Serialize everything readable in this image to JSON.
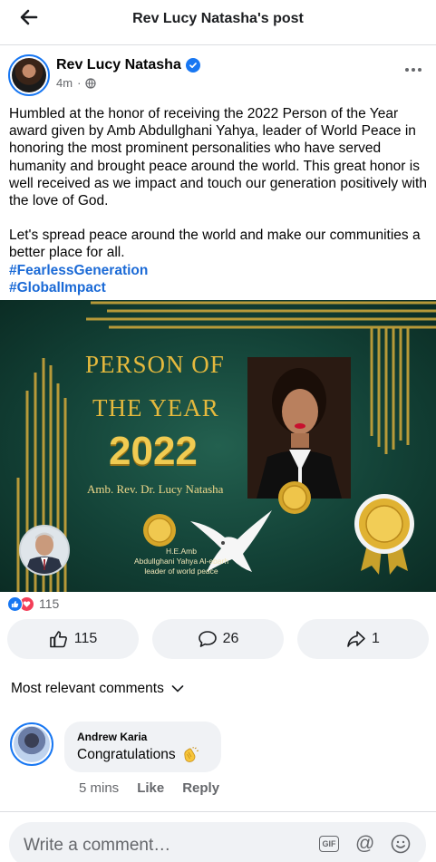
{
  "topbar": {
    "title": "Rev Lucy Natasha's post"
  },
  "post": {
    "author": "Rev Lucy Natasha",
    "time": "4m",
    "separator": "·",
    "text_paragraph1": "Humbled at the honor of receiving the 2022 Person of the Year award given by Amb Abdullghani Yahya, leader of World Peace in honoring the most prominent personalities who have served humanity and brought peace around the world. This great honor is well received as we impact and touch our generation positively with the love of God.",
    "text_paragraph2": "Let's spread peace around the world and make our communities a better place for all.",
    "hashtags": [
      "#FearlessGeneration",
      "#GlobalImpact"
    ]
  },
  "image": {
    "title_line1": "PERSON OF",
    "title_line2": "THE YEAR",
    "year": "2022",
    "recipient": "Amb. Rev. Dr. Lucy Natasha",
    "honoree_line1": "H.E.Amb",
    "honoree_line2": "Abdullghani Yahya Al-ebarh",
    "honoree_line3": "leader of world peace"
  },
  "reactions": {
    "count": "115"
  },
  "actions": {
    "likes": "115",
    "comments": "26",
    "shares": "1"
  },
  "comments_section": {
    "sort_label": "Most relevant comments",
    "comments": [
      {
        "author": "Andrew Karia",
        "text": "Congratulations",
        "time": "5 mins",
        "like_label": "Like",
        "reply_label": "Reply"
      }
    ]
  },
  "composer": {
    "placeholder": "Write a comment…",
    "gif_label": "GIF",
    "at_label": "@"
  },
  "colors": {
    "accent": "#1877f2",
    "hashtag": "#1b6ad6",
    "promo_green": "#134237",
    "gold": "#e5b93d"
  },
  "icons": [
    "back-arrow-icon",
    "verified-icon",
    "globe-icon",
    "more-icon",
    "like-icon",
    "love-icon",
    "thumbs-up-icon",
    "comment-icon",
    "share-icon",
    "chevron-down-icon",
    "clap-icon",
    "gif-icon",
    "at-icon",
    "emoji-icon"
  ]
}
